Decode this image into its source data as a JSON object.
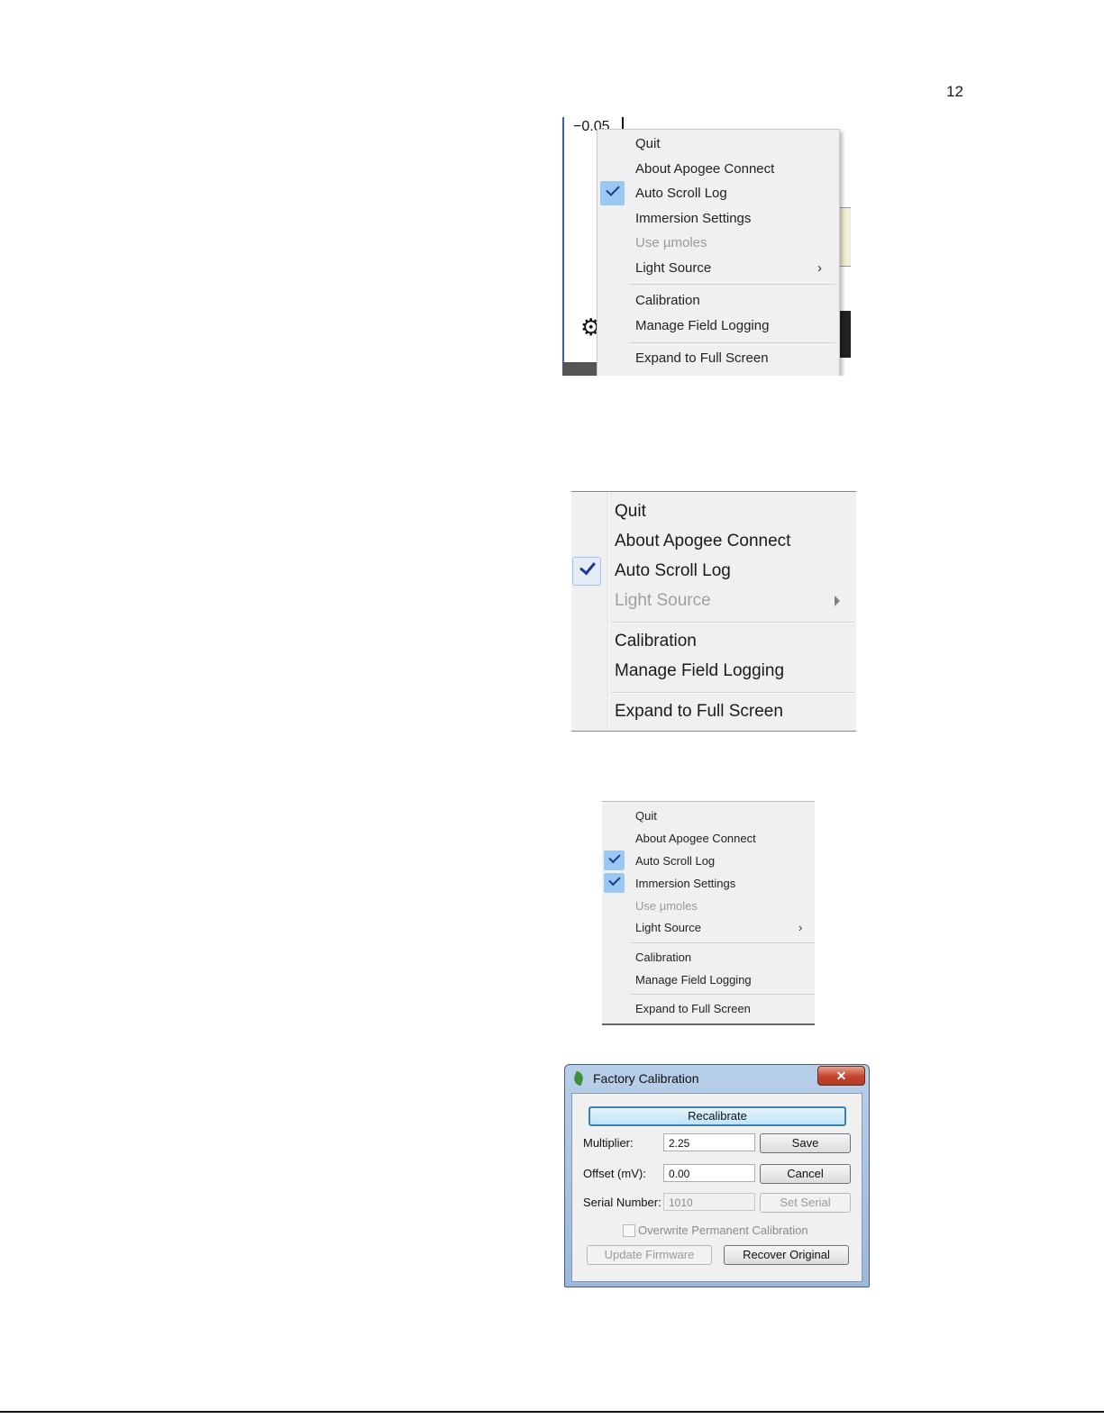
{
  "page": {
    "number": "12"
  },
  "menu1": {
    "axis_label": "−0.05",
    "items": [
      {
        "label": "Quit",
        "enabled": true,
        "checked": false
      },
      {
        "label": "About Apogee Connect",
        "enabled": true,
        "checked": false
      },
      {
        "label": "Auto Scroll Log",
        "enabled": true,
        "checked": true
      },
      {
        "label": "Immersion Settings",
        "enabled": true,
        "checked": false
      },
      {
        "label": "Use µmoles",
        "enabled": false,
        "checked": false
      },
      {
        "label": "Light Source",
        "enabled": true,
        "checked": false,
        "submenu": true
      },
      {
        "label": "Calibration",
        "enabled": true,
        "checked": false
      },
      {
        "label": "Manage Field Logging",
        "enabled": true,
        "checked": false
      },
      {
        "label": "Expand to Full Screen",
        "enabled": true,
        "checked": false
      }
    ]
  },
  "menu2": {
    "items": [
      {
        "label": "Quit",
        "enabled": true,
        "checked": false
      },
      {
        "label": "About Apogee Connect",
        "enabled": true,
        "checked": false
      },
      {
        "label": "Auto Scroll Log",
        "enabled": true,
        "checked": true
      },
      {
        "label": "Light Source",
        "enabled": false,
        "checked": false,
        "submenu": true
      },
      {
        "label": "Calibration",
        "enabled": true,
        "checked": false
      },
      {
        "label": "Manage Field Logging",
        "enabled": true,
        "checked": false
      },
      {
        "label": "Expand to Full Screen",
        "enabled": true,
        "checked": false
      }
    ]
  },
  "menu3": {
    "items": [
      {
        "label": "Quit",
        "enabled": true,
        "checked": false
      },
      {
        "label": "About Apogee Connect",
        "enabled": true,
        "checked": false
      },
      {
        "label": "Auto Scroll Log",
        "enabled": true,
        "checked": true
      },
      {
        "label": "Immersion Settings",
        "enabled": true,
        "checked": true
      },
      {
        "label": "Use µmoles",
        "enabled": false,
        "checked": false
      },
      {
        "label": "Light Source",
        "enabled": true,
        "checked": false,
        "submenu": true
      },
      {
        "label": "Calibration",
        "enabled": true,
        "checked": false
      },
      {
        "label": "Manage Field Logging",
        "enabled": true,
        "checked": false
      },
      {
        "label": "Expand to Full Screen",
        "enabled": true,
        "checked": false
      }
    ]
  },
  "dialog": {
    "title": "Factory Calibration",
    "close_glyph": "✕",
    "recalibrate_label": "Recalibrate",
    "multiplier_label": "Multiplier:",
    "multiplier_value": "2.25",
    "save_label": "Save",
    "offset_label": "Offset (mV):",
    "offset_value": "0.00",
    "cancel_label": "Cancel",
    "serial_label": "Serial Number:",
    "serial_value": "1010",
    "set_serial_label": "Set Serial",
    "overwrite_label": "Overwrite Permanent Calibration",
    "overwrite_checked": false,
    "update_firmware_label": "Update Firmware",
    "recover_original_label": "Recover Original"
  }
}
